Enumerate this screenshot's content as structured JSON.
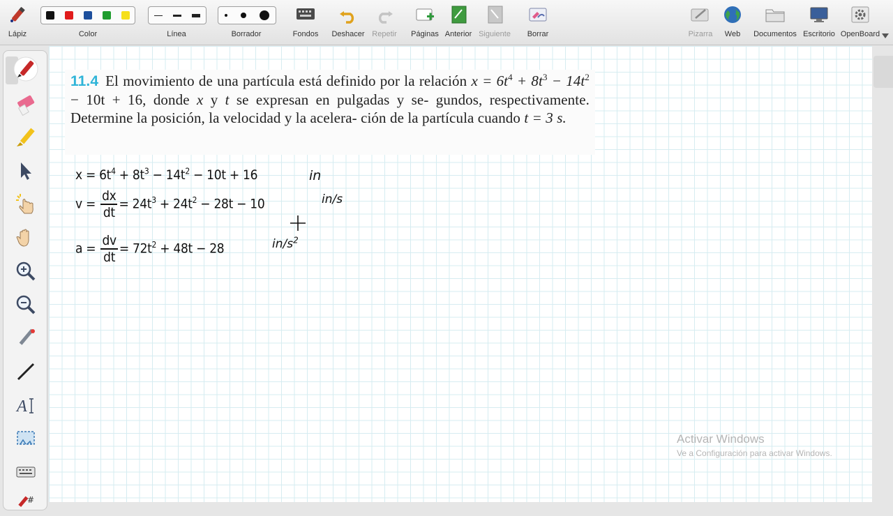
{
  "toolbar": {
    "pen_label": "Lápiz",
    "color_label": "Color",
    "colors": [
      "#111111",
      "#e01b1b",
      "#1d4f9c",
      "#1f9c2e",
      "#f5df1a"
    ],
    "line_label": "Línea",
    "eraser_label": "Borrador",
    "backgrounds_label": "Fondos",
    "undo_label": "Deshacer",
    "redo_label": "Repetir",
    "pages_label": "Páginas",
    "previous_label": "Anterior",
    "next_label": "Siguiente",
    "clear_label": "Borrar",
    "board_label": "Pizarra",
    "web_label": "Web",
    "documents_label": "Documentos",
    "desktop_label": "Escritorio",
    "openboard_label": "OpenBoard"
  },
  "problem": {
    "number": "11.4",
    "line1": "El movimiento de una partícula está definido por la relación",
    "line2_pre": "x = 6t",
    "exp4": "4",
    "l2_a": " + 8t",
    "exp3": "3",
    "l2_b": " − 14t",
    "exp2": "2",
    "l2_c": " − 10t + 16, donde ",
    "var_x": "x",
    "l2_d": " y ",
    "var_t": "t",
    "l2_e": " se expresan en pulgadas y se-",
    "line3": "gundos, respectivamente. Determine la posición, la velocidad y la acelera-",
    "line4_pre": "ción de la partícula cuando ",
    "line4_math": "t = 3 s."
  },
  "handwriting": {
    "x_eq_pre": "x = 6t",
    "x_e4": "4",
    "x_a": " + 8t",
    "x_e3": "3",
    "x_b": " − 14t",
    "x_e2": "2",
    "x_c": " − 10t + 16",
    "x_unit": "in",
    "v_pre": "v =",
    "v_num": "dx",
    "v_den": "dt",
    "v_a": "= 24t",
    "v_e3": "3",
    "v_b": " + 24t",
    "v_e2": "2",
    "v_c": " − 28t − 10",
    "v_unit": "in/s",
    "a_pre": "a =",
    "a_num": "dv",
    "a_den": "dt",
    "a_a": "= 72t",
    "a_e2": "2",
    "a_b": " + 48t − 28",
    "a_unit": "in/s",
    "a_unit_exp": "2"
  },
  "watermark": {
    "title": "Activar Windows",
    "subtitle": "Ve a Configuración para activar Windows."
  }
}
